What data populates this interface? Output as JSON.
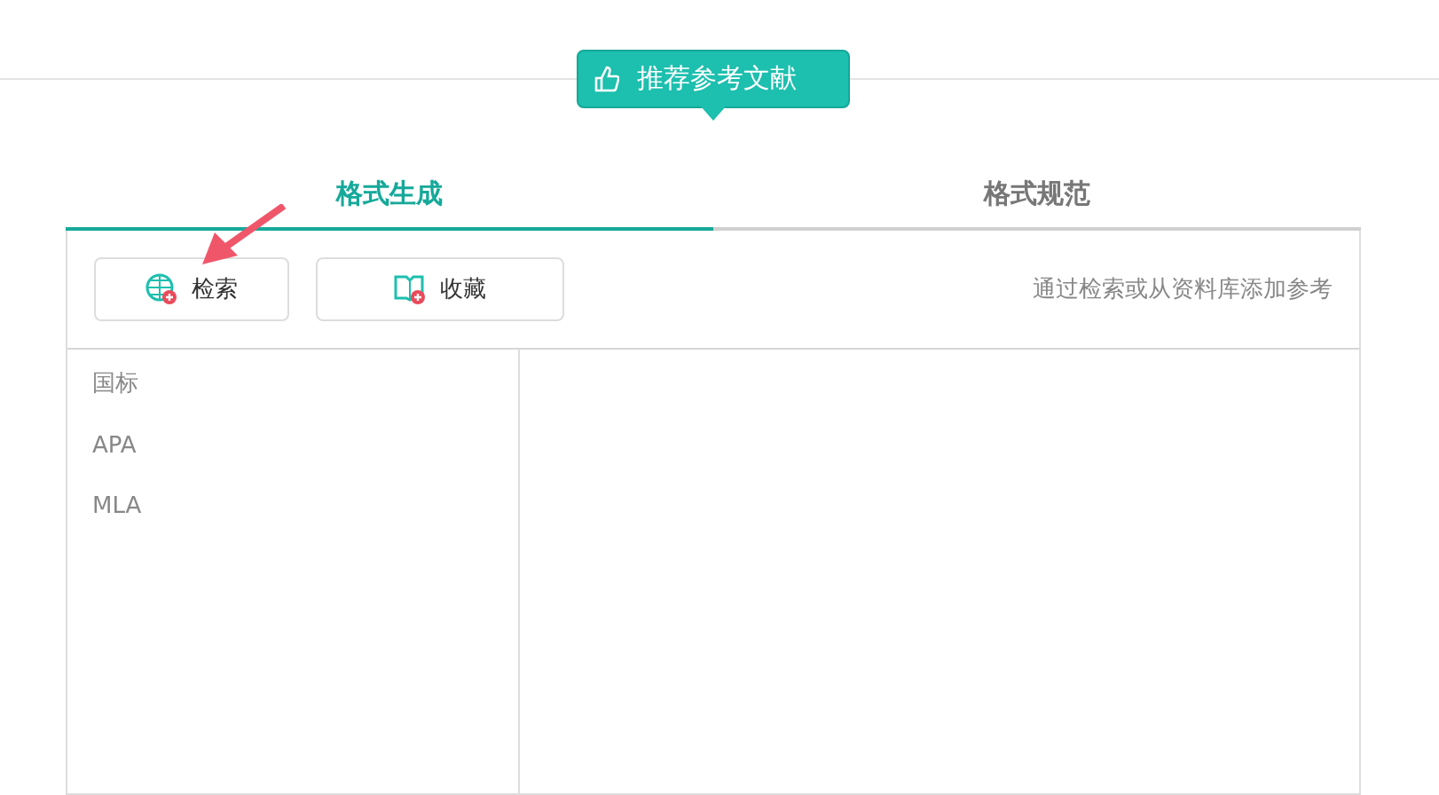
{
  "tooltip": {
    "label": "推荐参考文献"
  },
  "tabs": [
    {
      "label": "格式生成",
      "selected": true
    },
    {
      "label": "格式规范",
      "selected": false
    }
  ],
  "toolbar": {
    "buttons": [
      {
        "kind": "search",
        "label": "检索"
      },
      {
        "kind": "favorites",
        "label": "收藏"
      }
    ],
    "hint": "通过检索或从资料库添加参考"
  },
  "styles": [
    "国标",
    "APA",
    "MLA"
  ]
}
